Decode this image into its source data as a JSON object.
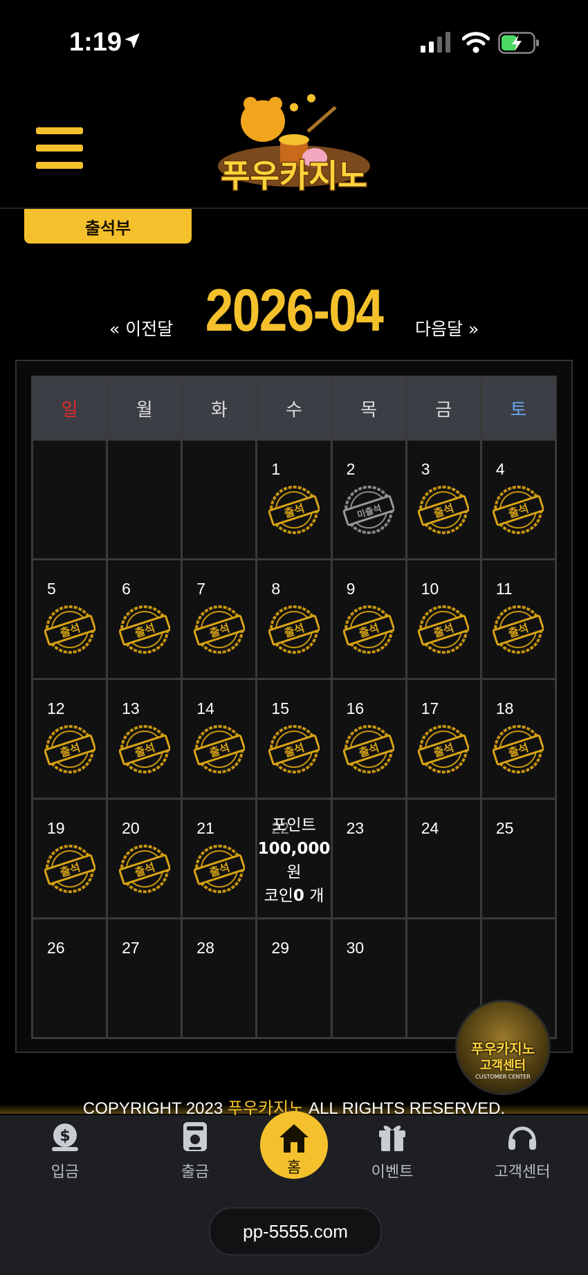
{
  "status_bar": {
    "time": "1:19"
  },
  "header": {
    "logo_text": "푸우카지노",
    "tab_label": "출석부"
  },
  "calendar": {
    "month": "2026-04",
    "prev_label": "« 이전달",
    "next_label": "다음달 »",
    "weekdays": [
      "일",
      "월",
      "화",
      "수",
      "목",
      "금",
      "토"
    ],
    "stamp_attended": "출석",
    "stamp_absent": "미출석",
    "days": [
      {
        "day": "",
        "stamp": ""
      },
      {
        "day": "",
        "stamp": ""
      },
      {
        "day": "",
        "stamp": ""
      },
      {
        "day": "1",
        "stamp": "attended"
      },
      {
        "day": "2",
        "stamp": "absent"
      },
      {
        "day": "3",
        "stamp": "attended"
      },
      {
        "day": "4",
        "stamp": "attended"
      },
      {
        "day": "5",
        "stamp": "attended"
      },
      {
        "day": "6",
        "stamp": "attended"
      },
      {
        "day": "7",
        "stamp": "attended"
      },
      {
        "day": "8",
        "stamp": "attended"
      },
      {
        "day": "9",
        "stamp": "attended"
      },
      {
        "day": "10",
        "stamp": "attended"
      },
      {
        "day": "11",
        "stamp": "attended"
      },
      {
        "day": "12",
        "stamp": "attended"
      },
      {
        "day": "13",
        "stamp": "attended"
      },
      {
        "day": "14",
        "stamp": "attended"
      },
      {
        "day": "15",
        "stamp": "attended"
      },
      {
        "day": "16",
        "stamp": "attended"
      },
      {
        "day": "17",
        "stamp": "attended"
      },
      {
        "day": "18",
        "stamp": "attended"
      },
      {
        "day": "19",
        "stamp": "attended"
      },
      {
        "day": "20",
        "stamp": "attended"
      },
      {
        "day": "21",
        "stamp": "attended"
      },
      {
        "day": "22",
        "stamp": "today"
      },
      {
        "day": "23",
        "stamp": ""
      },
      {
        "day": "24",
        "stamp": ""
      },
      {
        "day": "25",
        "stamp": ""
      },
      {
        "day": "26",
        "stamp": ""
      },
      {
        "day": "27",
        "stamp": ""
      },
      {
        "day": "28",
        "stamp": ""
      },
      {
        "day": "29",
        "stamp": ""
      },
      {
        "day": "30",
        "stamp": ""
      },
      {
        "day": "",
        "stamp": ""
      },
      {
        "day": "",
        "stamp": ""
      }
    ],
    "today_points": {
      "point_label": "포인트",
      "point_value": "100,000",
      "point_unit": "원",
      "coin_label": "코인",
      "coin_value": "0",
      "coin_unit": "개"
    }
  },
  "customer_center_badge": {
    "line1": "푸우카지노",
    "line2": "고객센터",
    "line3": "CUSTOMER CENTER"
  },
  "footer": {
    "copyright_prefix": "COPYRIGHT 2023",
    "copyright_brand": "푸우카지노",
    "copyright_suffix": "ALL RIGHTS RESERVED."
  },
  "bottom_nav": {
    "deposit": "입금",
    "withdraw": "출금",
    "home": "홈",
    "event": "이벤트",
    "support": "고객센터"
  },
  "url": "pp-5555.com",
  "colors": {
    "accent": "#f4c12c",
    "sunday": "#e02b2b",
    "saturday": "#6aa8f0"
  }
}
